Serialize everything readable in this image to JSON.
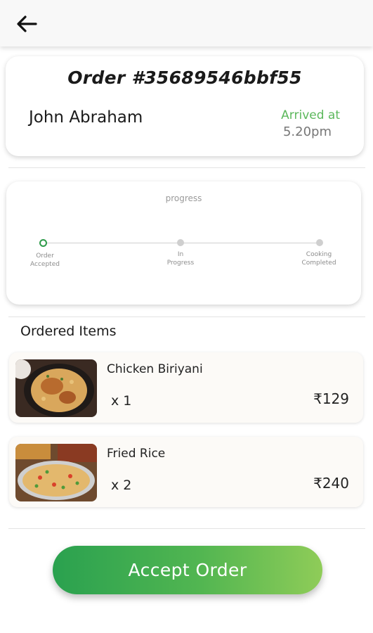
{
  "header": {
    "back_icon": "arrow-left-icon"
  },
  "order": {
    "title": "Order #35689546bbf55",
    "customer_name": "John Abraham",
    "arrived_label": "Arrived at",
    "arrived_time": "5.20pm"
  },
  "progress": {
    "title": "progress",
    "steps": [
      {
        "line1": "Order",
        "line2": "Accepted",
        "status": "active"
      },
      {
        "line1": "In",
        "line2": "Progress",
        "status": "pending"
      },
      {
        "line1": "Cooking",
        "line2": "Completed",
        "status": "pending"
      }
    ]
  },
  "items_section": {
    "title": "Ordered Items"
  },
  "items": [
    {
      "name": "Chicken Biriyani",
      "qty": "x 1",
      "price": "₹129"
    },
    {
      "name": "Fried Rice",
      "qty": "x 2",
      "price": "₹240"
    }
  ],
  "action": {
    "accept_label": "Accept Order"
  },
  "colors": {
    "accent_green": "#2e9b4a",
    "arrived_green": "#5cb85c"
  }
}
